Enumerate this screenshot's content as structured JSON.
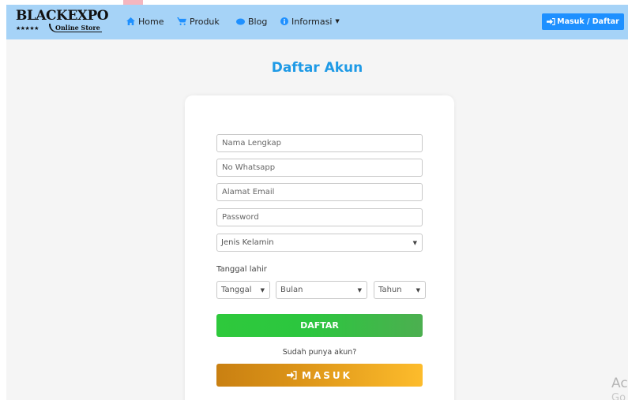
{
  "navbar": {
    "logo": {
      "title": "BLACKEXPO",
      "stars": "★★★★★",
      "subtitle": "Online Store"
    },
    "items": [
      {
        "label": "Home",
        "icon": "home-icon"
      },
      {
        "label": "Produk",
        "icon": "cart-icon"
      },
      {
        "label": "Blog",
        "icon": "blog-icon"
      },
      {
        "label": "Informasi",
        "icon": "info-icon",
        "dropdown": true
      }
    ],
    "login_label": "Masuk / Daftar"
  },
  "page_title": "Daftar Akun",
  "form": {
    "name_placeholder": "Nama Lengkap",
    "whatsapp_placeholder": "No Whatsapp",
    "email_placeholder": "Alamat Email",
    "password_placeholder": "Password",
    "gender_select": "Jenis Kelamin",
    "dob_label": "Tanggal lahir",
    "day_select": "Tanggal",
    "month_select": "Bulan",
    "year_select": "Tahun",
    "submit_label": "DAFTAR",
    "already_text": "Sudah punya akun?",
    "login_label": "MASUK"
  },
  "watermark": {
    "line1": "Ac",
    "line2": "Go"
  },
  "colors": {
    "navbar": "#a6d3f7",
    "accent": "#1e90ff",
    "title": "#1e9ae6",
    "daftar": "#2ec93c",
    "masuk": "#fdbc2c"
  }
}
